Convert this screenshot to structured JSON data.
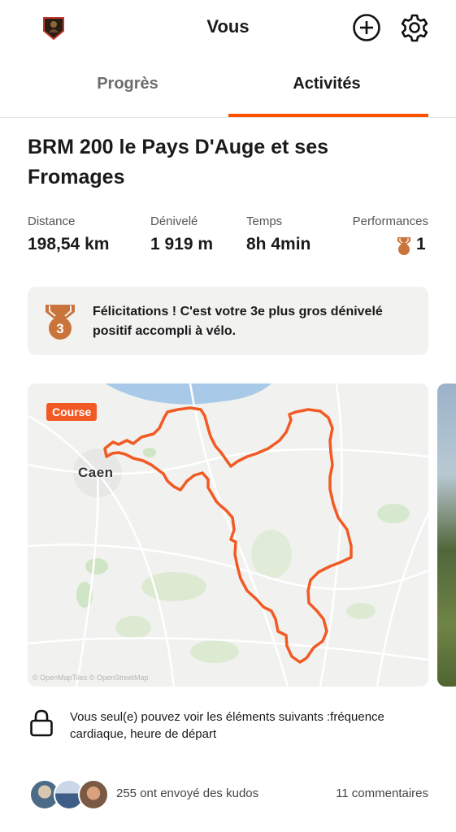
{
  "header": {
    "title": "Vous",
    "profile_icon": "athlete-badge-icon",
    "add_icon": "plus-circle-icon",
    "settings_icon": "gear-icon"
  },
  "tabs": [
    {
      "label": "Progrès",
      "active": false
    },
    {
      "label": "Activités",
      "active": true
    }
  ],
  "activity": {
    "title": "BRM 200 le Pays D'Auge et ses Fromages",
    "stats": [
      {
        "label": "Distance",
        "value": "198,54 km"
      },
      {
        "label": "Dénivelé",
        "value": "1 919 m"
      },
      {
        "label": "Temps",
        "value": "8h 4min"
      },
      {
        "label": "Performances",
        "value": "1",
        "icon": "medal-icon"
      }
    ]
  },
  "achievement": {
    "rank": "3",
    "text": "Félicitations ! C'est votre 3e plus gros dénivelé positif accompli à vélo.",
    "medal_color": "#c9743a"
  },
  "map": {
    "badge": "Course",
    "city": "Caen",
    "attribution": "© OpenMapTiles © OpenStreetMap",
    "route_color": "#f15a24"
  },
  "privacy": {
    "text": "Vous seul(e) pouvez voir les éléments suivants :fréquence cardiaque, heure de départ",
    "icon": "lock-icon"
  },
  "social": {
    "kudos_text": "255 ont envoyé des kudos",
    "comments_text": "11 commentaires"
  },
  "colors": {
    "accent": "#fc5200",
    "card_bg": "#f2f2f0"
  }
}
